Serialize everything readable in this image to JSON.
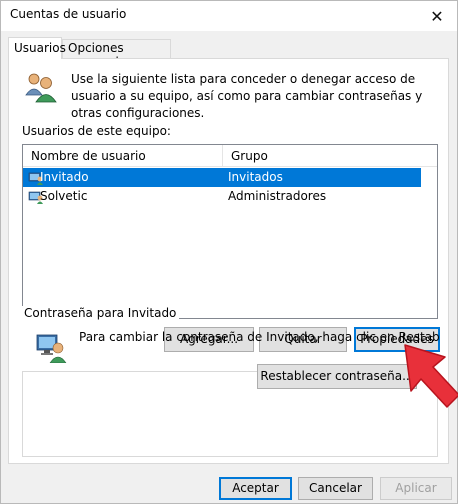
{
  "window": {
    "title": "Cuentas de usuario"
  },
  "tabs": [
    {
      "label": "Usuarios",
      "active": true
    },
    {
      "label": "Opciones avanzadas",
      "active": false
    }
  ],
  "intro": {
    "icon": "users-icon",
    "text": "Use la siguiente lista para conceder o denegar acceso de usuario a su equipo, así como para cambiar contraseñas y otras configuraciones."
  },
  "users_list": {
    "label": "Usuarios de este equipo:",
    "columns": [
      "Nombre de usuario",
      "Grupo"
    ],
    "rows": [
      {
        "name": "Invitado",
        "group": "Invitados",
        "selected": true
      },
      {
        "name": "Solvetic",
        "group": "Administradores",
        "selected": false
      }
    ]
  },
  "list_buttons": {
    "add": "Agregar...",
    "remove": "Quitar",
    "properties": "Propiedades"
  },
  "password_group": {
    "legend": "Contraseña para Invitado",
    "text": "Para cambiar la contraseña de Invitado, haga clic en Restablecer contraseña.",
    "reset_button": "Restablecer contraseña..."
  },
  "dialog_buttons": {
    "ok": "Aceptar",
    "cancel": "Cancelar",
    "apply": "Aplicar"
  },
  "colors": {
    "selection": "#0078d7",
    "annotation_arrow": "#e8303a"
  }
}
